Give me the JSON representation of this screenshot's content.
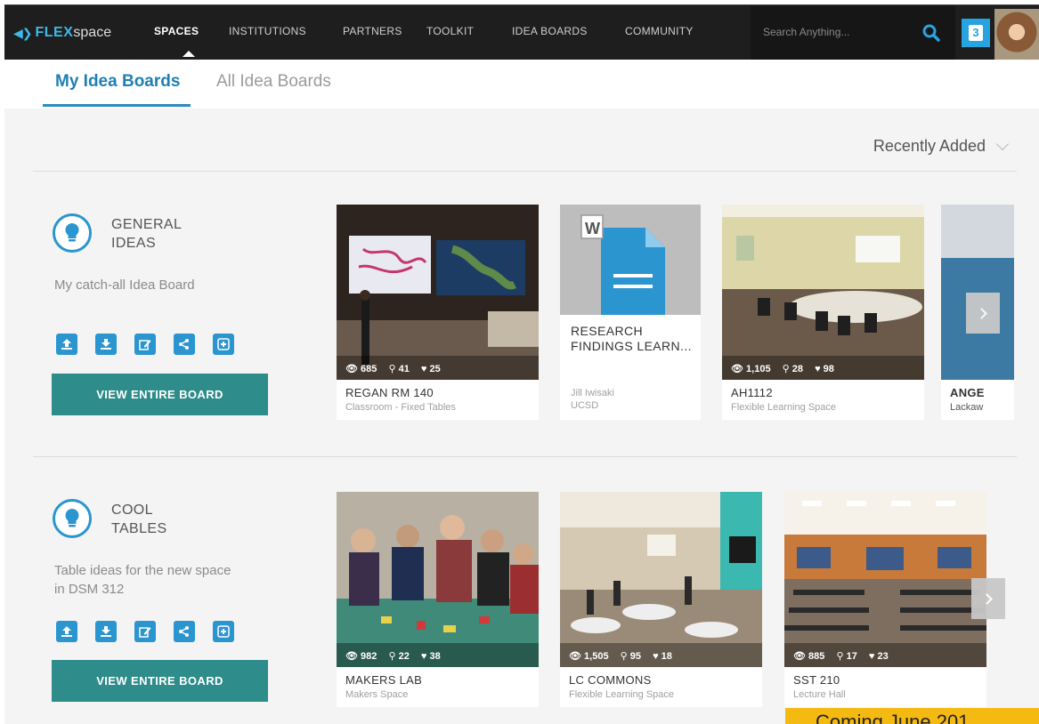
{
  "nav": {
    "logo_strong": "FLEX",
    "logo_light": "space",
    "items": [
      {
        "label": "SPACES",
        "active": true
      },
      {
        "label": "INSTITUTIONS",
        "active": false
      },
      {
        "label": "PARTNERS",
        "active": false
      },
      {
        "label": "TOOLKIT",
        "active": false
      },
      {
        "label": "IDEA BOARDS",
        "active": false
      },
      {
        "label": "COMMUNITY",
        "active": false
      }
    ],
    "search_placeholder": "Search Anything...",
    "notification_count": "3"
  },
  "tabs": {
    "mine": "My Idea Boards",
    "all": "All Idea Boards"
  },
  "sort": {
    "label": "Recently Added"
  },
  "boards": [
    {
      "title_line1": "GENERAL",
      "title_line2": "IDEAS",
      "description": "My catch-all Idea Board",
      "button_label": "VIEW ENTIRE BOARD",
      "cards": [
        {
          "title": "REGAN RM 140",
          "subtitle": "Classroom - Fixed Tables",
          "views": "685",
          "pins": "41",
          "likes": "25"
        },
        {
          "title_line1": "RESEARCH",
          "title_line2": "FINDINGS LEARN...",
          "author": "Jill Iwisaki",
          "org": "UCSD"
        },
        {
          "title": "AH1112",
          "subtitle": "Flexible Learning Space",
          "views": "1,105",
          "pins": "28",
          "likes": "98"
        },
        {
          "title": "ANGE",
          "subtitle": "Lackaw"
        }
      ]
    },
    {
      "title_line1": "COOL",
      "title_line2": "TABLES",
      "description": "Table ideas for the new space in DSM 312",
      "button_label": "VIEW ENTIRE BOARD",
      "cards": [
        {
          "title": "MAKERS LAB",
          "subtitle": "Makers Space",
          "views": "982",
          "pins": "22",
          "likes": "38"
        },
        {
          "title": "LC COMMONS",
          "subtitle": "Flexible Learning Space",
          "views": "1,505",
          "pins": "95",
          "likes": "18"
        },
        {
          "title": "SST 210",
          "subtitle": "Lecture Hall",
          "views": "885",
          "pins": "17",
          "likes": "23"
        }
      ]
    }
  ],
  "banner": {
    "text": "Coming June 201"
  },
  "colors": {
    "nav_bg": "#1e1e1e",
    "accent_blue": "#2a95cf",
    "button_teal": "#2e8c8a",
    "banner_yellow": "#f5ba12"
  }
}
